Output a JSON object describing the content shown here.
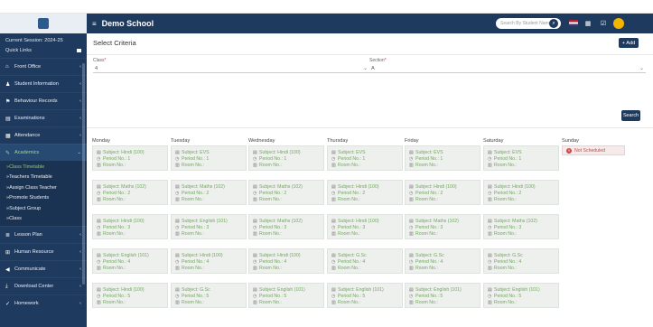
{
  "app": {
    "title": "Demo School"
  },
  "session": {
    "line": "Current Session: 2024-25",
    "quick_links": "Quick Links"
  },
  "header": {
    "search_placeholder": "Search By Student Name"
  },
  "sidebar": {
    "items": [
      {
        "label": "Front Office",
        "icon": "building-icon"
      },
      {
        "label": "Student Information",
        "icon": "user-icon"
      },
      {
        "label": "Behaviour Records",
        "icon": "flag-icon"
      },
      {
        "label": "Examinations",
        "icon": "map-icon"
      },
      {
        "label": "Attendance",
        "icon": "calendar-icon"
      },
      {
        "label": "Academics",
        "icon": "academics-icon"
      }
    ],
    "subitems": [
      "Class Timetable",
      "Teachers Timetable",
      "Assign Class Teacher",
      "Promote Students",
      "Subject Group",
      "Class"
    ],
    "items_after": [
      {
        "label": "Lesson Plan",
        "icon": "list-icon"
      },
      {
        "label": "Human Resource",
        "icon": "sitemap-icon"
      },
      {
        "label": "Communicate",
        "icon": "bullhorn-icon"
      },
      {
        "label": "Download Center",
        "icon": "download-icon"
      },
      {
        "label": "Homework",
        "icon": "homework-icon"
      }
    ]
  },
  "criteria": {
    "title": "Select Criteria",
    "add_label": "+ Add",
    "class_label": "Class",
    "class_value": "4",
    "section_label": "Section",
    "section_value": "A",
    "search_label": "Search"
  },
  "timetable": {
    "days": [
      "Monday",
      "Tuesday",
      "Wednesday",
      "Thursday",
      "Friday",
      "Saturday",
      "Sunday"
    ],
    "not_scheduled": "Not Scheduled",
    "room_label": "Room No.:",
    "rows": [
      [
        "Subject: Hindi (100)",
        "Subject: EVS",
        "Subject: Hindi (100)",
        "Subject: EVS",
        "Subject: EVS",
        "Subject: EVS"
      ],
      [
        "Subject: Maths (102)",
        "Subject: Maths (102)",
        "Subject: Maths (102)",
        "Subject: Hindi (100)",
        "Subject: Hindi (100)",
        "Subject: Hindi (100)"
      ],
      [
        "Subject: Hindi (100)",
        "Subject: English (101)",
        "Subject: Maths (102)",
        "Subject: Hindi (100)",
        "Subject: Maths (102)",
        "Subject: Maths (102)"
      ],
      [
        "Subject: English (101)",
        "Subject: Hindi (100)",
        "Subject: Hindi (100)",
        "Subject: G.Sc",
        "Subject: G.Sc",
        "Subject: G.Sc"
      ],
      [
        "Subject: Hindi (100)",
        "Subject: G.Sc",
        "Subject: English (101)",
        "Subject: English (101)",
        "Subject: English (101)",
        "Subject: English (101)"
      ]
    ],
    "periods": [
      "Period No.: 1",
      "Period No.: 2",
      "Period No.: 3",
      "Period No.: 4",
      "Period No.: 5"
    ]
  }
}
